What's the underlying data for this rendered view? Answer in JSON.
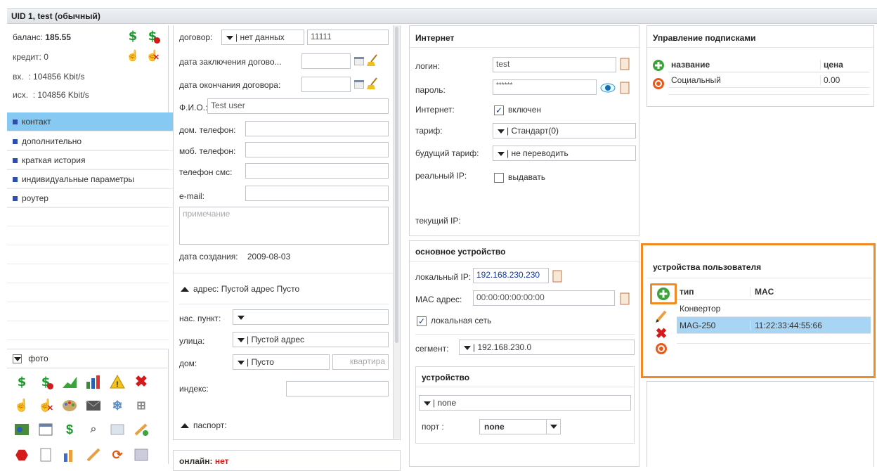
{
  "window": {
    "title": "UID 1, test (обычный)"
  },
  "left": {
    "balance_label": "баланс:",
    "balance_value": "185.55",
    "credit_label": "кредит:",
    "credit_value": "0",
    "in_label": "вх.",
    "in_value": ": 104856 Kbit/s",
    "out_label": "исх.",
    "out_value": ": 104856 Kbit/s",
    "nav": [
      "контакт",
      "дополнительно",
      "краткая история",
      "индивидуальные параметры",
      "роутер"
    ],
    "photo_label": "фото"
  },
  "contract": {
    "contract_label": "договор:",
    "contract_select": "| нет данных",
    "contract_value": "11111",
    "date_start_label": "дата заключения догово...",
    "date_end_label": "дата окончания договора:",
    "fio_label": "Ф.И.О.:",
    "fio_value": "Test user",
    "home_phone_label": "дом. телефон:",
    "mob_phone_label": "моб. телефон:",
    "sms_phone_label": "телефон смс:",
    "email_label": "e-mail:",
    "note_placeholder": "примечание",
    "created_label": "дата создания:",
    "created_value": "2009-08-03",
    "address_label": "адрес: Пустой адрес Пусто",
    "city_label": "нас. пункт:",
    "street_label": "улица:",
    "street_value": "| Пустой адрес",
    "house_label": "дом:",
    "house_value": "| Пусто",
    "flat_placeholder": "квартира",
    "index_label": "индекс:",
    "passport_label": "паспорт:",
    "online_label": "онлайн:",
    "online_value": "нет"
  },
  "internet": {
    "title": "Интернет",
    "login_label": "логин:",
    "login_value": "test",
    "password_label": "пароль:",
    "password_value": "******",
    "internet_label": "Интернет:",
    "internet_check": "включен",
    "tariff_label": "тариф:",
    "tariff_value": "| Стандарт(0)",
    "future_tariff_label": "будущий тариф:",
    "future_tariff_value": "| не переводить",
    "real_ip_label": "реальный IP:",
    "real_ip_check": "выдавать",
    "current_ip_label": "текущий IP:"
  },
  "main_device": {
    "title": "основное устройство",
    "local_ip_label": "локальный IP:",
    "local_ip_value": "192.168.230.230",
    "mac_label": "MAC адрес:",
    "mac_value": "00:00:00:00:00:00",
    "local_net_check": "локальная сеть",
    "segment_label": "сегмент:",
    "segment_value": "| 192.168.230.0",
    "device_title": "устройство",
    "device_value": "| none",
    "port_label": "порт :",
    "port_value": "none"
  },
  "subscriptions": {
    "title": "Управление подписками",
    "col_name": "название",
    "col_price": "цена",
    "rows": [
      {
        "name": "Социальный",
        "price": "0.00"
      }
    ]
  },
  "user_devices": {
    "title": "устройства пользователя",
    "col_type": "тип",
    "col_mac": "MAC",
    "rows": [
      {
        "type": "Конвертор",
        "mac": ""
      },
      {
        "type": "MAG-250",
        "mac": "11:22:33:44:55:66"
      }
    ]
  },
  "colors": {
    "accent": "#f08a24",
    "selection": "#a9d5f5",
    "nav_selected": "#86c9f2",
    "link": "#1a3aaa",
    "red": "#d41a1a"
  }
}
